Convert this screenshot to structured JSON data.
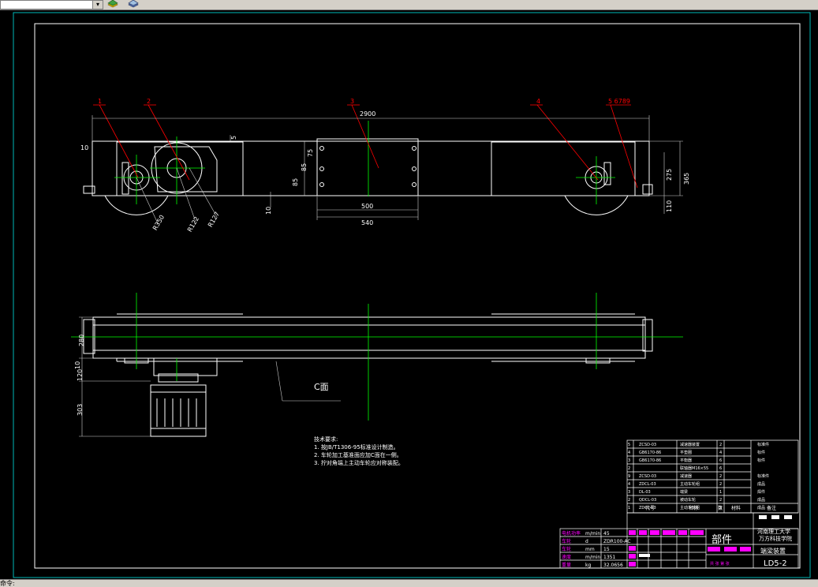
{
  "toolbar": {
    "layer_combo": "",
    "dropdown_glyph": "▾",
    "icons": [
      "layer-icon",
      "layer-properties-icon"
    ]
  },
  "drawing": {
    "part_labels": [
      "1",
      "2",
      "3",
      "4",
      "5 6789"
    ],
    "dims_top": {
      "overall": "2900",
      "d10_left": "10",
      "d5": "5",
      "d10_mid": "10",
      "d85_a": "85",
      "d85_b": "85",
      "d75": "75",
      "d500": "500",
      "d540": "540",
      "d275": "275",
      "d365": "365",
      "d110": "110",
      "r_wheel": "R350",
      "r122": "R122",
      "r127": "R127"
    },
    "dims_bottom": {
      "d280": "280",
      "d120": "120",
      "d10": "10",
      "d303": "303"
    },
    "section_label": "C面",
    "notes": {
      "title": "技术要求:",
      "items": [
        "1. 按JB/T1306-95标准设计制造。",
        "2. 车轮加工基准面应加C面在一侧。",
        "3. 拧对角端上主动车轮应对称装配。"
      ]
    },
    "bom": {
      "rows": [
        {
          "no": "5",
          "code": "ZCSD-03",
          "name": "减速器装置",
          "qty": "2",
          "note": "标准件"
        },
        {
          "no": "4",
          "code": "GB6170-86",
          "name": "平垫圈",
          "qty": "4",
          "note": "标件"
        },
        {
          "no": "3",
          "code": "GB6170-86",
          "name": "平衡器",
          "qty": "6",
          "note": "标件"
        },
        {
          "no": "2",
          "code": "",
          "name": "联轴器M16×55",
          "qty": "6",
          "note": ""
        },
        {
          "no": "9",
          "code": "ZCSD-03",
          "name": "减速器",
          "qty": "2",
          "note": "标准件"
        },
        {
          "no": "4",
          "code": "ZDCL-03",
          "name": "主动车轮组",
          "qty": "2",
          "note": "成品"
        },
        {
          "no": "3",
          "code": "DL-03",
          "name": "端梁",
          "qty": "1",
          "note": "焊件"
        },
        {
          "no": "2",
          "code": "QDCL-03",
          "name": "被动车轮",
          "qty": "2",
          "note": "成品"
        },
        {
          "no": "1",
          "code": "ZDCL-03",
          "name": "主动车轮组",
          "qty": "2",
          "note": "成品"
        }
      ],
      "header": [
        "代号",
        "名称",
        "数",
        "材料",
        "备注"
      ]
    },
    "title_block": {
      "school": "河南理工大学",
      "college": "万方科技学院",
      "kind": "部件",
      "part_name": "端梁装置",
      "drawing_no": "LD5-2",
      "left_params": [
        {
          "label": "电机功率",
          "unit": "m/min",
          "value": "45"
        },
        {
          "label": "车轮",
          "unit": "d",
          "value": "ZDR100-AC"
        },
        {
          "label": "车轮",
          "unit": "mm",
          "value": "15"
        },
        {
          "label": "速度",
          "unit": "m/min",
          "value": "1351"
        },
        {
          "label": "重量",
          "unit": "kg",
          "value": "32.0656"
        }
      ],
      "sheets": "共  张  第  张"
    }
  },
  "statusbar": {
    "text": "命令:"
  },
  "colors": {
    "background": "#000000",
    "frame": "#ffffff",
    "centerline": "#00ff00",
    "leader": "#ff0000",
    "dimension": "#00ffff",
    "outline": "#ffffff",
    "annotation": "#ff00ff",
    "border_cyan": "#00d8d8"
  }
}
